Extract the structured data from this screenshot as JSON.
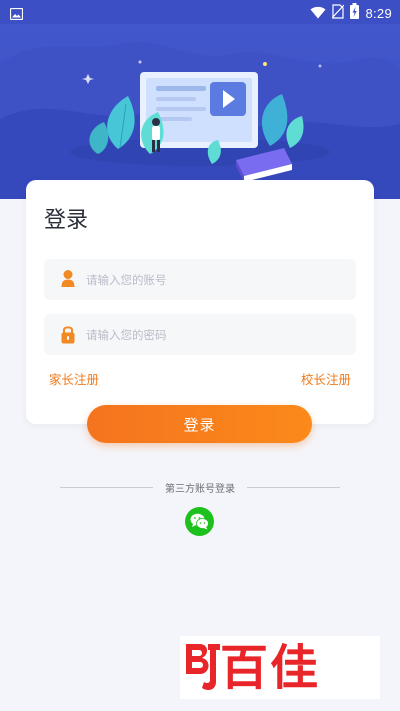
{
  "status_bar": {
    "time": "8:29",
    "icons": [
      "gallery-icon",
      "wifi-icon",
      "no-sim-icon",
      "battery-charging-icon"
    ]
  },
  "colors": {
    "banner_blue": "#3c53c8",
    "accent_orange": "#f5741f",
    "wechat_green": "#1dc11d",
    "page_background": "#f4f5fa"
  },
  "login_card": {
    "title": "登录",
    "account_field": {
      "value": "",
      "placeholder": "请输入您的账号",
      "icon": "user-icon"
    },
    "password_field": {
      "value": "",
      "placeholder": "请输入您的密码",
      "icon": "lock-icon"
    },
    "parent_register_link": "家长注册",
    "school_register_link": "校长注册"
  },
  "login_button": {
    "label": "登录"
  },
  "third_party": {
    "label": "第三方账号登录",
    "providers": [
      "wechat-icon"
    ]
  },
  "watermark": {
    "text": "百佳",
    "logo_letters": "BJ"
  }
}
